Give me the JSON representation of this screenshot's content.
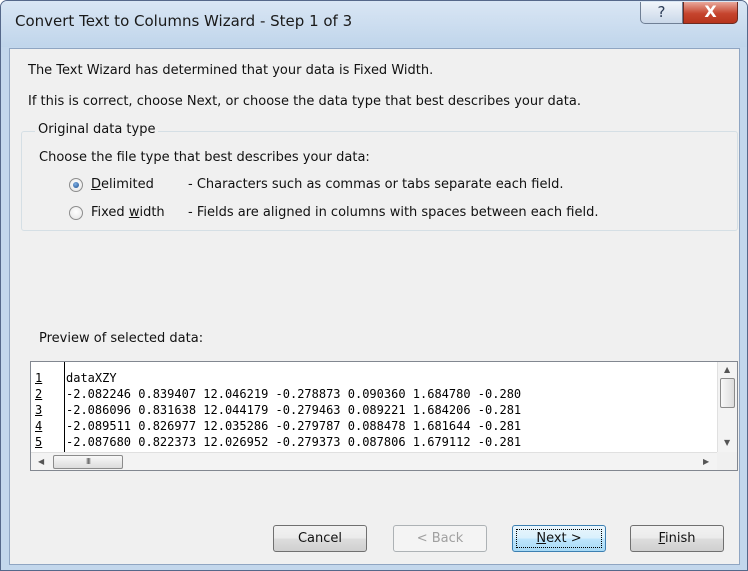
{
  "window": {
    "title": "Convert Text to Columns Wizard - Step 1 of 3",
    "help_glyph": "?",
    "close_glyph": "X"
  },
  "intro": {
    "line1": "The Text Wizard has determined that your data is Fixed Width.",
    "line2": "If this is correct, choose Next, or choose the data type that best describes your data."
  },
  "original_type": {
    "legend": "Original data type",
    "prompt": "Choose the file type that best describes your data:",
    "options": [
      {
        "pre": "",
        "key": "D",
        "post": "elimited",
        "description": "- Characters such as commas or tabs separate each field.",
        "selected": true
      },
      {
        "pre": "Fixed ",
        "key": "w",
        "post": "idth",
        "description": "- Fields are aligned in columns with spaces between each field.",
        "selected": false
      }
    ]
  },
  "preview": {
    "label": "Preview of selected data:",
    "rows": [
      {
        "num": "1",
        "text": "dataXZY"
      },
      {
        "num": "2",
        "text": "-2.082246 0.839407 12.046219 -0.278873 0.090360 1.684780 -0.280"
      },
      {
        "num": "3",
        "text": "-2.086096 0.831638 12.044179 -0.279463 0.089221 1.684206 -0.281"
      },
      {
        "num": "4",
        "text": "-2.089511 0.826977 12.035286 -0.279787 0.088478 1.681644 -0.281"
      },
      {
        "num": "5",
        "text": "-2.087680 0.822373 12.026952 -0.279373 0.087806 1.679112 -0.281"
      }
    ],
    "scroll_up": "▲",
    "scroll_down": "▼",
    "scroll_left": "◀",
    "scroll_right": "▶",
    "thumb_grip": "III"
  },
  "buttons": {
    "cancel": "Cancel",
    "back": "< Back",
    "next_key": "N",
    "next_rest": "ext >",
    "finish_key": "F",
    "finish_rest": "inish"
  }
}
